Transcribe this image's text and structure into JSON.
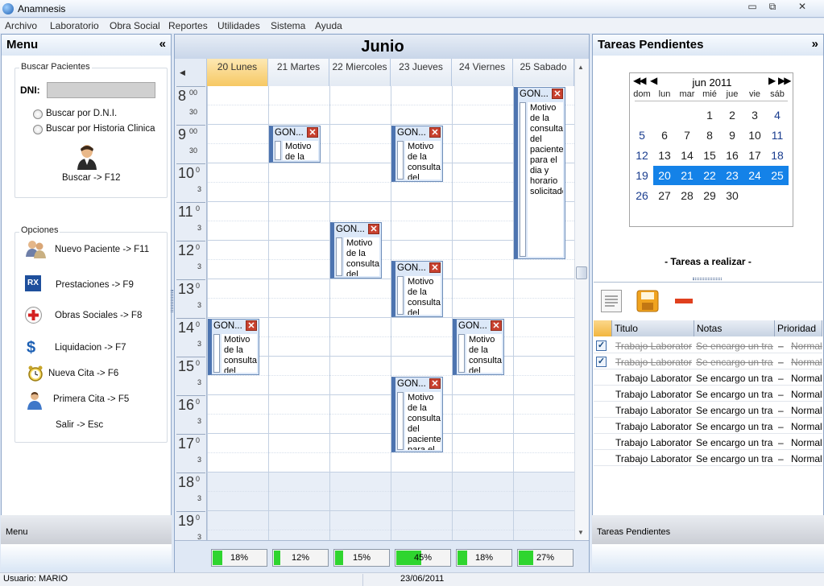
{
  "window": {
    "title": "Anamnesis",
    "minimize": "▭",
    "restore": "⧉",
    "close": "✕"
  },
  "menu": [
    "Archivo",
    "Laboratorio",
    "Obra Social",
    "Reportes",
    "Utilidades",
    "Sistema",
    "Ayuda"
  ],
  "left": {
    "title": "Menu",
    "collapse": "«",
    "search_group": "Buscar Pacientes",
    "dni_label": "DNI:",
    "dni_value": "",
    "radio1": "Buscar por D.N.I.",
    "radio2": "Buscar por Historia Clinica",
    "search_button": "Buscar -> F12",
    "options_group": "Opciones",
    "options": [
      {
        "label": "Nuevo Paciente -> F11",
        "icon": "users-icon"
      },
      {
        "label": "Prestaciones -> F9",
        "icon": "rx-icon"
      },
      {
        "label": "Obras Sociales -> F8",
        "icon": "red-cross-icon"
      },
      {
        "label": "Liquidacion -> F7",
        "icon": "dollar-icon"
      },
      {
        "label": "Nueva Cita -> F6",
        "icon": "alarm-clock-icon"
      },
      {
        "label": "Primera Cita -> F5",
        "icon": "user-icon"
      },
      {
        "label": "Salir -> Esc",
        "icon": ""
      }
    ],
    "footer": "Menu"
  },
  "calendar": {
    "month": "Junio",
    "days": [
      "20 Lunes",
      "21 Martes",
      "22 Miercoles",
      "23 Jueves",
      "24 Viernes",
      "25 Sabado"
    ],
    "hours": [
      "8",
      "9",
      "10",
      "11",
      "12",
      "13",
      "14",
      "15",
      "16",
      "17",
      "18",
      "19"
    ],
    "half_label": "30",
    "zero_label": "00",
    "short_zero": "0",
    "short_half": "3",
    "appointment_title": "GON...",
    "appointments": [
      {
        "day": 5,
        "start": 0,
        "end": 9,
        "text": "Motivo de la consulta del paciente para el dia y horario solicitado"
      },
      {
        "day": 1,
        "start": 2,
        "end": 4,
        "text": "Motivo de la consulta del paciente"
      },
      {
        "day": 3,
        "start": 2,
        "end": 5,
        "text": "Motivo de la consulta del paciente para el dia y"
      },
      {
        "day": 2,
        "start": 7,
        "end": 10,
        "text": "Motivo de la consulta del paciente para el dia y"
      },
      {
        "day": 3,
        "start": 9,
        "end": 12,
        "text": "Motivo de la consulta del paciente para el dia y"
      },
      {
        "day": 0,
        "start": 12,
        "end": 15,
        "text": "Motivo de la consulta del paciente para el dia y horario solicitado"
      },
      {
        "day": 4,
        "start": 12,
        "end": 15,
        "text": "Motivo de la consulta del paciente para el dia y horario solicitado"
      },
      {
        "day": 3,
        "start": 15,
        "end": 19,
        "text": "Motivo de la consulta del paciente para el dia y"
      }
    ],
    "progress": [
      {
        "label": "18%",
        "value": 0.18
      },
      {
        "label": "12%",
        "value": 0.12
      },
      {
        "label": "15%",
        "value": 0.15
      },
      {
        "label": "45%",
        "value": 0.45
      },
      {
        "label": "18%",
        "value": 0.18
      },
      {
        "label": "27%",
        "value": 0.27
      }
    ]
  },
  "right": {
    "title": "Tareas Pendientes",
    "collapse": "»",
    "minical": {
      "month": "jun 2011",
      "dow": [
        "dom",
        "lun",
        "mar",
        "mié",
        "jue",
        "vie",
        "sáb"
      ],
      "weeks": [
        [
          "",
          "",
          "",
          "1",
          "2",
          "3",
          "4"
        ],
        [
          "5",
          "6",
          "7",
          "8",
          "9",
          "10",
          "11"
        ],
        [
          "12",
          "13",
          "14",
          "15",
          "16",
          "17",
          "18"
        ],
        [
          "19",
          "20",
          "21",
          "22",
          "23",
          "24",
          "25"
        ],
        [
          "26",
          "27",
          "28",
          "29",
          "30",
          "",
          ""
        ]
      ],
      "selected": [
        "20",
        "21",
        "22",
        "23",
        "24",
        "25"
      ]
    },
    "tasks_label": "- Tareas a realizar -",
    "columns": [
      "Titulo",
      "Notas",
      "Prioridad"
    ],
    "rows": [
      {
        "checked": true,
        "title": "Trabajo Laboratorio",
        "notes": "Se encargo un trab...",
        "dash": "–",
        "priority": "Normal"
      },
      {
        "checked": true,
        "title": "Trabajo Laboratorio",
        "notes": "Se encargo un trab...",
        "dash": "–",
        "priority": "Normal"
      },
      {
        "checked": false,
        "title": "Trabajo Laboratorio",
        "notes": "Se encargo un trab...",
        "dash": "–",
        "priority": "Normal"
      },
      {
        "checked": false,
        "title": "Trabajo Laboratorio",
        "notes": "Se encargo un trab...",
        "dash": "–",
        "priority": "Normal"
      },
      {
        "checked": false,
        "title": "Trabajo Laboratorio",
        "notes": "Se encargo un trab...",
        "dash": "–",
        "priority": "Normal"
      },
      {
        "checked": false,
        "title": "Trabajo Laboratorio",
        "notes": "Se encargo un trab...",
        "dash": "–",
        "priority": "Normal"
      },
      {
        "checked": false,
        "title": "Trabajo Laboratorio",
        "notes": "Se encargo un trab...",
        "dash": "–",
        "priority": "Normal"
      },
      {
        "checked": false,
        "title": "Trabajo Laboratorio",
        "notes": "Se encargo un trab...",
        "dash": "–",
        "priority": "Normal"
      }
    ],
    "footer": "Tareas Pendientes"
  },
  "status": {
    "user": "Usuario: MARIO",
    "date": "23/06/2011"
  },
  "colors": {
    "selected_day": "#1482e8",
    "today_header": "#f6c863",
    "progress": "#2fd52f",
    "close_red": "#c8412f"
  }
}
